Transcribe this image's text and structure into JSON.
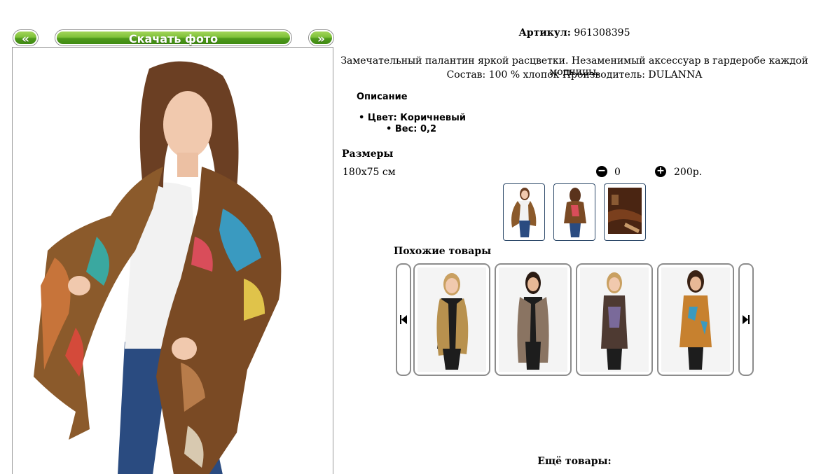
{
  "nav": {
    "prev_label": "«",
    "download_label": "Скачать фото",
    "next_label": "»"
  },
  "product": {
    "sku_label": "Артикул:",
    "sku_value": "961308395",
    "description_line1": "Замечательный палантин яркой расцветки. Незаменимый аксессуар в гардеробе каждой модницы.",
    "description_line2": "Состав: 100 % хлопок Производитель: DULANNA",
    "specs_heading": "Описание",
    "spec_color": "Цвет: Коричневый",
    "spec_weight": "Вес: 0,2",
    "sizes_heading": "Размеры",
    "size_value": "180x75 см",
    "quantity": "0",
    "price": "200р.",
    "minus_icon": "minus-circle-icon",
    "plus_icon": "plus-circle-icon"
  },
  "thumbnails": [
    {
      "name": "front"
    },
    {
      "name": "back"
    },
    {
      "name": "fabric-closeup"
    }
  ],
  "similar": {
    "heading": "Похожие товары",
    "prev_icon": "skip-back-icon",
    "next_icon": "skip-forward-icon",
    "items": [
      {
        "scarf_color": "#b8914e"
      },
      {
        "scarf_color": "#8a7462"
      },
      {
        "scarf_color": "#4e3a32"
      },
      {
        "scarf_color": "#c7812f"
      }
    ]
  },
  "more_heading": "Ещё товары:",
  "colors": {
    "button_green": "#5aa524",
    "thumb_border": "#2e4a6a",
    "card_border": "#8c8c8c"
  }
}
